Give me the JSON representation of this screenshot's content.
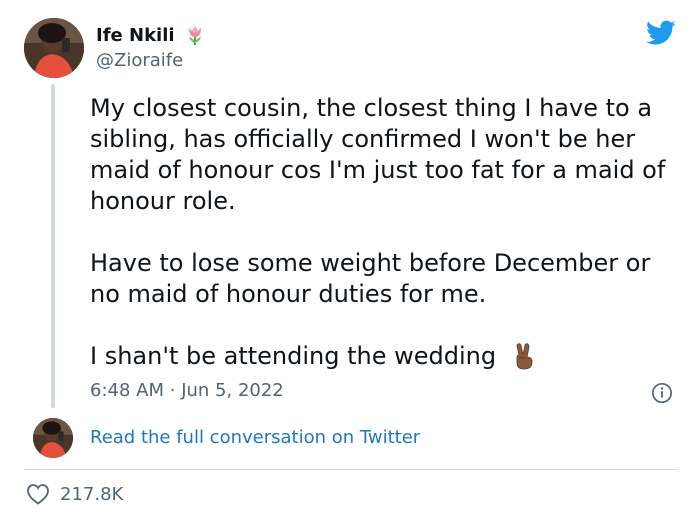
{
  "author": {
    "display_name": "Ife Nkili",
    "handle": "@Zioraife"
  },
  "tweet": {
    "paragraphs": [
      "My closest cousin, the closest thing I have to a sibling, has officially confirmed I won't be her maid of honour cos I'm just too fat for a maid of honour role.",
      "Have to lose some weight before December or no maid of honour duties for me.",
      "I shan't be attending the wedding"
    ],
    "time": "6:48 AM",
    "separator": "·",
    "date": "Jun 5, 2022"
  },
  "read_more_label": "Read the full conversation on Twitter",
  "likes_count": "217.8K",
  "icons": {
    "name_badge": "tulip-emoji",
    "brand": "twitter-bird-icon",
    "emoji": "victory-hand-emoji",
    "info": "info-icon",
    "like": "heart-outline-icon"
  },
  "colors": {
    "text": "#0f1419",
    "muted": "#536471",
    "link": "#1d78c1",
    "brand": "#1d9bf0",
    "divider": "#cfd9de"
  }
}
